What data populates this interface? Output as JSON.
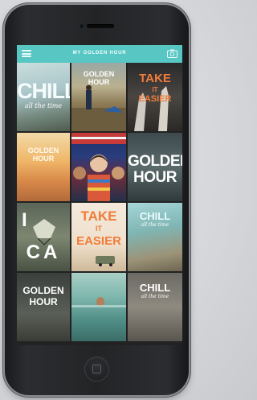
{
  "app": {
    "title": "MY GOLDEN HOUR"
  },
  "icons": {
    "menu": "menu-icon",
    "camera": "camera-icon"
  },
  "colors": {
    "nav_bar": "#58c6c3",
    "accent_orange": "#f07c3a"
  },
  "grid": [
    {
      "line1": "CHILL",
      "line2": "all the time"
    },
    {
      "line1": "GOLDEN",
      "line2": "HOUR"
    },
    {
      "line1": "TAKE",
      "line2": "IT",
      "line3": "EASIER"
    },
    {
      "line1": "GOLDEN",
      "line2": "HOUR"
    },
    {
      "line1": ""
    },
    {
      "line1": "GOLDEN",
      "line2": "HOUR"
    },
    {
      "line1": "I",
      "line2": "CA"
    },
    {
      "line1": "TAKE",
      "line2": "IT",
      "line3": "EASIER"
    },
    {
      "line1": "CHILL",
      "line2": "all the time"
    },
    {
      "line1": "GOLDEN",
      "line2": "HOUR"
    },
    {
      "line1": ""
    },
    {
      "line1": "CHILL",
      "line2": "all the time"
    }
  ]
}
